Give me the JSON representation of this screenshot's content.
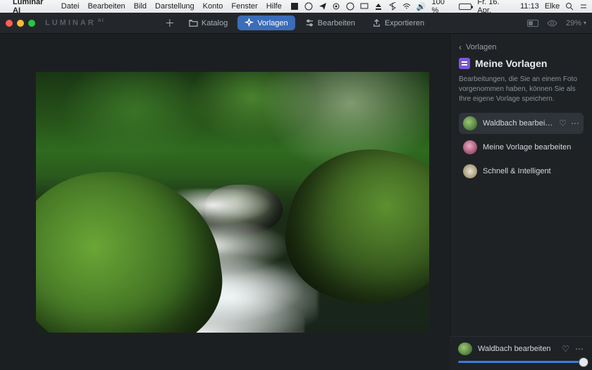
{
  "menubar": {
    "app": "Luminar AI",
    "items": [
      "Datei",
      "Bearbeiten",
      "Bild",
      "Darstellung",
      "Konto",
      "Fenster",
      "Hilfe"
    ],
    "right": {
      "volume_pct": "100 %",
      "date": "Fr. 16. Apr.",
      "time": "11:13",
      "user": "Elke"
    }
  },
  "brand": {
    "name": "LUMINAR",
    "suffix": "AI"
  },
  "toolbar": {
    "katalog": "Katalog",
    "vorlagen": "Vorlagen",
    "bearbeiten": "Bearbeiten",
    "exportieren": "Exportieren"
  },
  "zoom": "29%",
  "sidebar": {
    "crumb": "Vorlagen",
    "title": "Meine Vorlagen",
    "description": "Bearbeitungen, die Sie an einem Foto vorgenommen haben, können Sie als Ihre eigene Vorlage speichern.",
    "templates": [
      {
        "label": "Waldbach bearbeiten"
      },
      {
        "label": "Meine Vorlage bearbeiten"
      },
      {
        "label": "Schnell & Intelligent"
      }
    ]
  },
  "bottom": {
    "label": "Waldbach bearbeiten"
  }
}
